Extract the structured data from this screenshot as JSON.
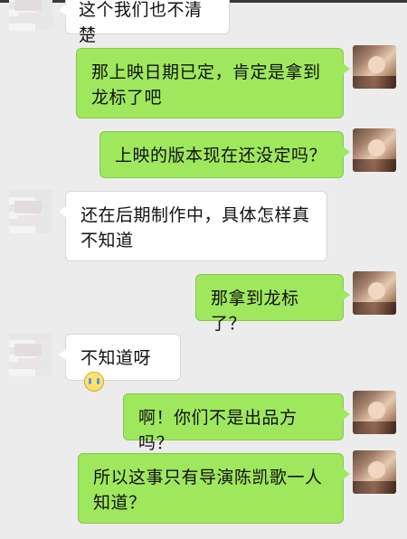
{
  "chat": {
    "messages": [
      {
        "side": "left",
        "text": "这个我们也不清楚"
      },
      {
        "side": "right",
        "text": "那上映日期已定，肯定是拿到龙标了吧"
      },
      {
        "side": "right",
        "text": "上映的版本现在还没定吗？"
      },
      {
        "side": "left",
        "text": "还在后期制作中，具体怎样真不知道"
      },
      {
        "side": "right",
        "text": "那拿到龙标了？"
      },
      {
        "side": "left",
        "text": "不知道呀",
        "emoji": "crying-face-emoji"
      },
      {
        "side": "right",
        "text": "啊！你们不是出品方吗？"
      },
      {
        "side": "right",
        "text": "所以这事只有导演陈凯歌一人知道？"
      }
    ]
  },
  "colors": {
    "background": "#ececec",
    "sent_bubble": "#9fe85e",
    "received_bubble": "#ffffff"
  }
}
